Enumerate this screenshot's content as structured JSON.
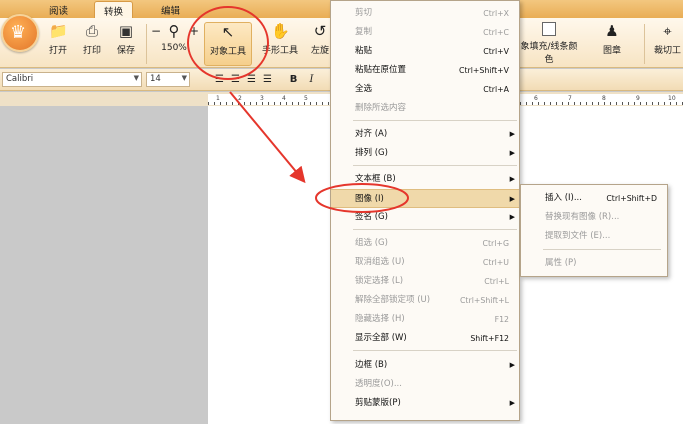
{
  "tabs": [
    {
      "label": "阅读",
      "active": false
    },
    {
      "label": "转换",
      "active": true
    },
    {
      "label": "编辑",
      "active": false
    }
  ],
  "ribbon": {
    "open": "打开",
    "print": "打印",
    "save": "保存",
    "zoom_out": "−",
    "zoom_in": "+",
    "zoom_level": "150%",
    "object_tool": "对象工具",
    "hand_tool": "手形工具",
    "left_partial": "左旋",
    "fill_stroke": "象填充/线条颜",
    "fill_stroke_2": "色",
    "stamp": "图章",
    "crop_tool": "裁切工"
  },
  "format": {
    "font_name": "Calibri",
    "font_size": "14",
    "bold": "B",
    "italic": "I"
  },
  "ruler": {
    "numbers": [
      "1",
      "2",
      "3",
      "4",
      "5",
      "6",
      "7",
      "8",
      "9",
      "10"
    ]
  },
  "context_menu": {
    "items": [
      {
        "label": "剪切",
        "shortcut": "Ctrl+X",
        "enabled": false
      },
      {
        "label": "复制",
        "shortcut": "Ctrl+C",
        "enabled": false
      },
      {
        "label": "粘贴",
        "shortcut": "Ctrl+V",
        "enabled": true
      },
      {
        "label": "粘贴在原位置",
        "shortcut": "Ctrl+Shift+V",
        "enabled": true
      },
      {
        "label": "全选",
        "shortcut": "Ctrl+A",
        "enabled": true
      },
      {
        "label": "删除所选内容",
        "shortcut": "",
        "enabled": false
      },
      {
        "label": "对齐 (A)",
        "shortcut": "",
        "enabled": true,
        "submenu": true
      },
      {
        "label": "排列 (G)",
        "shortcut": "",
        "enabled": true,
        "submenu": true
      },
      {
        "label": "文本框 (B)",
        "shortcut": "",
        "enabled": true,
        "submenu": true
      },
      {
        "label": "图像 (I)",
        "shortcut": "",
        "enabled": true,
        "submenu": true,
        "highlighted": true
      },
      {
        "label": "签名 (G)",
        "shortcut": "",
        "enabled": true,
        "submenu": true
      },
      {
        "label": "组选 (G)",
        "shortcut": "Ctrl+G",
        "enabled": false
      },
      {
        "label": "取消组选 (U)",
        "shortcut": "Ctrl+U",
        "enabled": false
      },
      {
        "label": "锁定选择 (L)",
        "shortcut": "Ctrl+L",
        "enabled": false
      },
      {
        "label": "解除全部锁定项 (U)",
        "shortcut": "Ctrl+Shift+L",
        "enabled": false
      },
      {
        "label": "隐藏选择 (H)",
        "shortcut": "F12",
        "enabled": false
      },
      {
        "label": "显示全部 (W)",
        "shortcut": "Shift+F12",
        "enabled": true
      },
      {
        "label": "边框 (B)",
        "shortcut": "",
        "enabled": true,
        "submenu": true
      },
      {
        "label": "透明度(O)...",
        "shortcut": "",
        "enabled": false
      },
      {
        "label": "剪贴蒙版(P)",
        "shortcut": "",
        "enabled": true,
        "submenu": true
      }
    ]
  },
  "image_submenu": {
    "items": [
      {
        "label": "插入 (I)...",
        "shortcut": "Ctrl+Shift+D",
        "enabled": true
      },
      {
        "label": "替换现有图像 (R)...",
        "shortcut": "",
        "enabled": false
      },
      {
        "label": "提取到文件 (E)...",
        "shortcut": "",
        "enabled": false
      },
      {
        "label": "属性 (P)",
        "shortcut": "",
        "enabled": false
      }
    ]
  },
  "colors": {
    "annotation": "#e5362c",
    "highlight": "#f0d9aa",
    "ribbon_top": "#fff8ec",
    "tab_bar": "#e9ad55"
  }
}
